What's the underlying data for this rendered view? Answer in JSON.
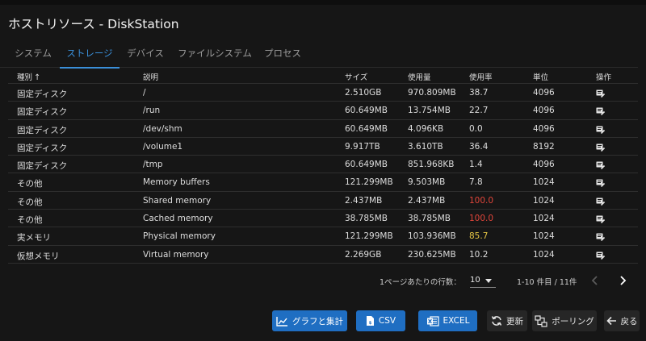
{
  "window": {
    "title": "ホストリソース - DiskStation"
  },
  "tabs": [
    {
      "label": "システム"
    },
    {
      "label": "ストレージ"
    },
    {
      "label": "デバイス"
    },
    {
      "label": "ファイルシステム"
    },
    {
      "label": "プロセス"
    }
  ],
  "active_tab": "ストレージ",
  "table": {
    "headers": {
      "type": "種別",
      "description": "説明",
      "size": "サイズ",
      "used": "使用量",
      "usage_rate": "使用率",
      "unit": "単位",
      "action": "操作"
    },
    "sort": {
      "column": "種別",
      "direction": "ascending",
      "icon": "arrow-up-icon"
    },
    "rows": [
      {
        "type": "固定ディスク",
        "description": "/",
        "size": "2.510GB",
        "used": "970.809MB",
        "usage_rate": "38.7",
        "unit": "4096"
      },
      {
        "type": "固定ディスク",
        "description": "/run",
        "size": "60.649MB",
        "used": "13.754MB",
        "usage_rate": "22.7",
        "unit": "4096"
      },
      {
        "type": "固定ディスク",
        "description": "/dev/shm",
        "size": "60.649MB",
        "used": "4.096KB",
        "usage_rate": "0.0",
        "unit": "4096"
      },
      {
        "type": "固定ディスク",
        "description": "/volume1",
        "size": "9.917TB",
        "used": "3.610TB",
        "usage_rate": "36.4",
        "unit": "8192"
      },
      {
        "type": "固定ディスク",
        "description": "/tmp",
        "size": "60.649MB",
        "used": "851.968KB",
        "usage_rate": "1.4",
        "unit": "4096"
      },
      {
        "type": "その他",
        "description": "Memory buffers",
        "size": "121.299MB",
        "used": "9.503MB",
        "usage_rate": "7.8",
        "unit": "1024"
      },
      {
        "type": "その他",
        "description": "Shared memory",
        "size": "2.437MB",
        "used": "2.437MB",
        "usage_rate": "100.0",
        "unit": "1024",
        "rate_color": "#e0453a"
      },
      {
        "type": "その他",
        "description": "Cached memory",
        "size": "38.785MB",
        "used": "38.785MB",
        "usage_rate": "100.0",
        "unit": "1024",
        "rate_color": "#e0453a"
      },
      {
        "type": "実メモリ",
        "description": "Physical memory",
        "size": "121.299MB",
        "used": "103.936MB",
        "usage_rate": "85.7",
        "unit": "1024",
        "rate_color": "#e5c545"
      },
      {
        "type": "仮想メモリ",
        "description": "Virtual memory",
        "size": "2.269GB",
        "used": "230.625MB",
        "usage_rate": "10.2",
        "unit": "1024"
      }
    ],
    "row_action_icon": "edit-note-icon"
  },
  "pagination": {
    "rows_per_page_label": "1ページあたりの行数：",
    "rows_per_page": "10",
    "range_text": "1-10 件目 / 11件",
    "prev_icon": "chevron-left-icon",
    "next_icon": "chevron-right-icon"
  },
  "buttons": {
    "chart": {
      "label": "グラフと集計",
      "icon": "line-chart-icon"
    },
    "csv": {
      "label": "CSV",
      "icon": "csv-file-icon"
    },
    "excel": {
      "label": "EXCEL",
      "icon": "excel-icon"
    },
    "refresh": {
      "label": "更新",
      "icon": "refresh-icon"
    },
    "polling": {
      "label": "ポーリング",
      "icon": "polling-icon"
    },
    "back": {
      "label": "戻る",
      "icon": "arrow-left-icon"
    }
  },
  "colors": {
    "accent": "#3a8fd9",
    "button_blue": "#1f6ec2",
    "background": "#161616",
    "critical": "#e0453a",
    "warning": "#e5c545"
  }
}
